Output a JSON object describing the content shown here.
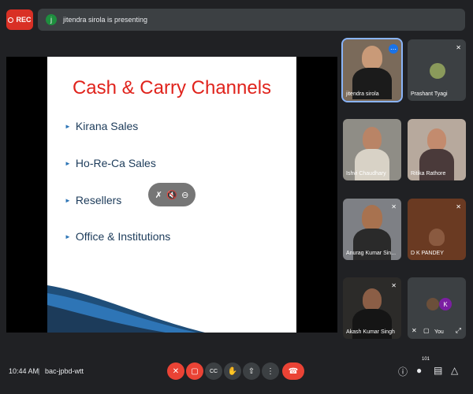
{
  "top": {
    "rec_label": "REC",
    "presenter_initial": "j",
    "presenting_text": "jitendra sirola is presenting"
  },
  "slide": {
    "title": "Cash & Carry Channels",
    "bullets": [
      "Kirana Sales",
      "Ho-Re-Ca  Sales",
      "Resellers",
      "Office & Institutions"
    ]
  },
  "tiles": [
    {
      "name": "jitendra sirola"
    },
    {
      "name": "Prashant Tyagi"
    },
    {
      "name": "Ishvi Chaudhary"
    },
    {
      "name": "Ritika Rathore"
    },
    {
      "name": "Anurag Kumar Sin..."
    },
    {
      "name": "D K PANDEY"
    },
    {
      "name": "Akash Kumar Singh"
    },
    {
      "name": "You",
      "avatar_initial": "K"
    }
  ],
  "bottom": {
    "time": "10:44 AM",
    "separator": "|",
    "meeting_code": "bac-jpbd-wtt",
    "participants_count": "101"
  },
  "colors": {
    "background": "#202124",
    "rec": "#d93025",
    "hangup": "#ea4335",
    "title_red": "#e0231c"
  }
}
